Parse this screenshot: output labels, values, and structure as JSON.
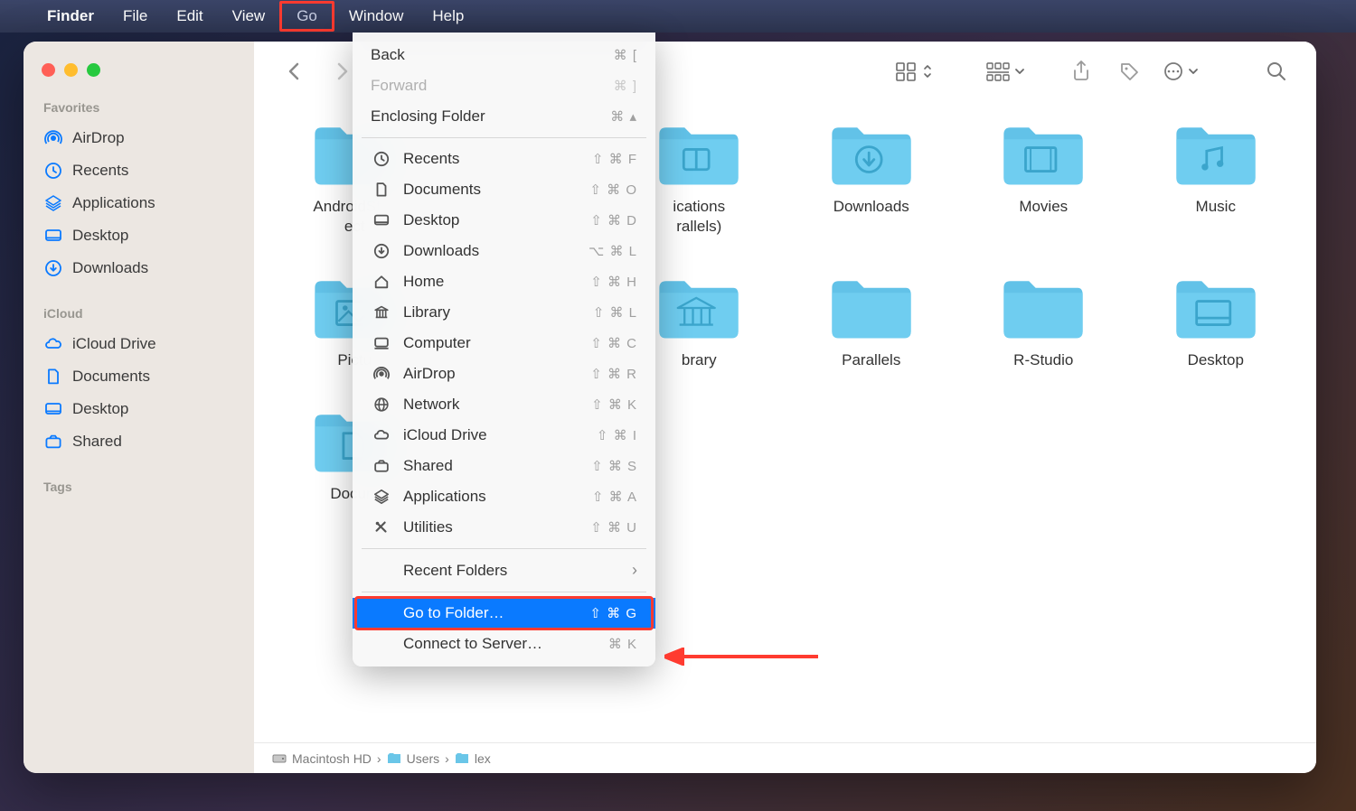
{
  "menubar": {
    "app": "Finder",
    "items": [
      "File",
      "Edit",
      "View",
      "Go",
      "Window",
      "Help"
    ],
    "highlighted": "Go"
  },
  "sidebar": {
    "sections": [
      {
        "heading": "Favorites",
        "items": [
          {
            "icon": "airdrop",
            "label": "AirDrop"
          },
          {
            "icon": "clock",
            "label": "Recents"
          },
          {
            "icon": "apps",
            "label": "Applications"
          },
          {
            "icon": "desktop",
            "label": "Desktop"
          },
          {
            "icon": "download",
            "label": "Downloads"
          }
        ]
      },
      {
        "heading": "iCloud",
        "items": [
          {
            "icon": "icloud",
            "label": "iCloud Drive"
          },
          {
            "icon": "document",
            "label": "Documents"
          },
          {
            "icon": "desktop",
            "label": "Desktop"
          },
          {
            "icon": "shared",
            "label": "Shared"
          }
        ]
      },
      {
        "heading": "Tags",
        "items": []
      }
    ]
  },
  "folders": [
    {
      "name": "AndroidStudioProjects",
      "glyph": "plain",
      "label_override": "AndroidSt…\nect"
    },
    {
      "name": "",
      "glyph": "hidden"
    },
    {
      "name": "Applications (Parallels)",
      "glyph": "apps",
      "label_override": "ications\nrallels)"
    },
    {
      "name": "Downloads",
      "glyph": "download"
    },
    {
      "name": "Movies",
      "glyph": "movie"
    },
    {
      "name": "Music",
      "glyph": "music"
    },
    {
      "name": "Pictures",
      "glyph": "image",
      "label_override": "Pictu"
    },
    {
      "name": "",
      "glyph": "hidden"
    },
    {
      "name": "Library",
      "glyph": "library",
      "label_override": "brary"
    },
    {
      "name": "Parallels",
      "glyph": "plain"
    },
    {
      "name": "R-Studio",
      "glyph": "plain"
    },
    {
      "name": "Desktop",
      "glyph": "desktop"
    },
    {
      "name": "Documents",
      "glyph": "document",
      "label_override": "Docum"
    }
  ],
  "pathbar": [
    "Macintosh HD",
    "Users",
    "lex"
  ],
  "dropdown": {
    "groups": [
      [
        {
          "label": "Back",
          "shortcut": "⌘ [",
          "disabled": false
        },
        {
          "label": "Forward",
          "shortcut": "⌘ ]",
          "disabled": true
        },
        {
          "label": "Enclosing Folder",
          "shortcut": "⌘ ▴",
          "disabled": false
        }
      ],
      [
        {
          "icon": "clock",
          "label": "Recents",
          "shortcut": "⇧ ⌘ F"
        },
        {
          "icon": "document",
          "label": "Documents",
          "shortcut": "⇧ ⌘ O"
        },
        {
          "icon": "desktop",
          "label": "Desktop",
          "shortcut": "⇧ ⌘ D"
        },
        {
          "icon": "download",
          "label": "Downloads",
          "shortcut": "⌥ ⌘ L"
        },
        {
          "icon": "home",
          "label": "Home",
          "shortcut": "⇧ ⌘ H"
        },
        {
          "icon": "library",
          "label": "Library",
          "shortcut": "⇧ ⌘ L"
        },
        {
          "icon": "computer",
          "label": "Computer",
          "shortcut": "⇧ ⌘ C"
        },
        {
          "icon": "airdrop",
          "label": "AirDrop",
          "shortcut": "⇧ ⌘ R"
        },
        {
          "icon": "network",
          "label": "Network",
          "shortcut": "⇧ ⌘ K"
        },
        {
          "icon": "icloud",
          "label": "iCloud Drive",
          "shortcut": "⇧ ⌘ I"
        },
        {
          "icon": "shared",
          "label": "Shared",
          "shortcut": "⇧ ⌘ S"
        },
        {
          "icon": "apps",
          "label": "Applications",
          "shortcut": "⇧ ⌘ A"
        },
        {
          "icon": "utilities",
          "label": "Utilities",
          "shortcut": "⇧ ⌘ U"
        }
      ],
      [
        {
          "label": "Recent Folders",
          "submenu": true
        }
      ],
      [
        {
          "label": "Go to Folder…",
          "shortcut": "⇧ ⌘ G",
          "highlighted": true
        },
        {
          "label": "Connect to Server…",
          "shortcut": "⌘ K"
        }
      ]
    ]
  },
  "annotations": {
    "go_menu_box": true,
    "go_to_folder_box": true,
    "arrow": true
  }
}
